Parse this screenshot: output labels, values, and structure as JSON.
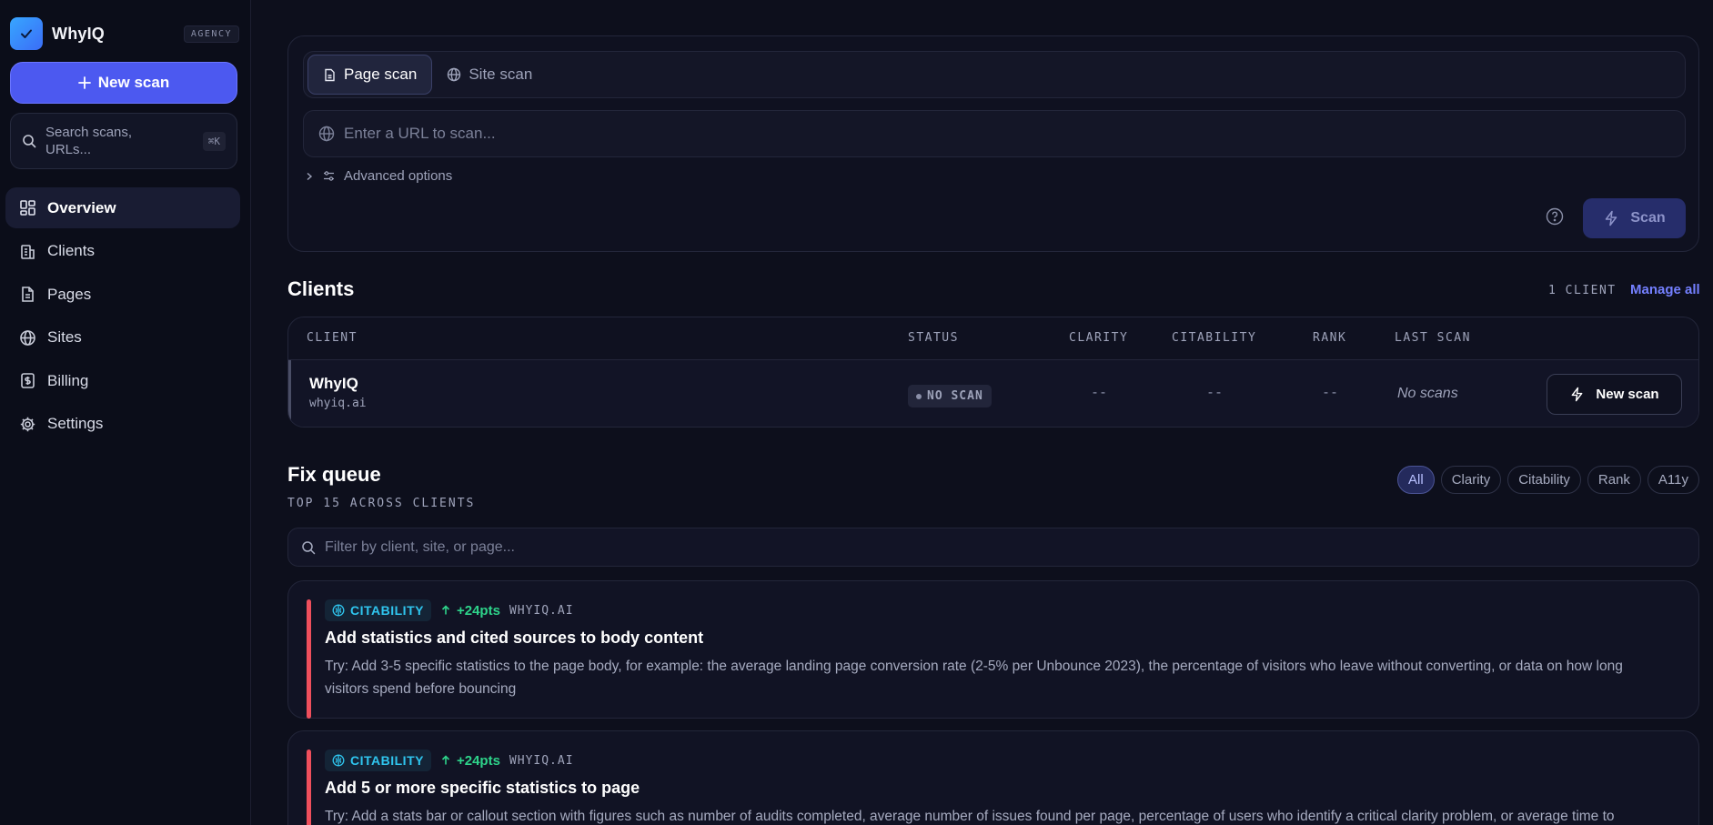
{
  "sidebar": {
    "brand": "WhyIQ",
    "badge": "AGENCY",
    "new_scan": "New scan",
    "search_placeholder": "Search scans, URLs...",
    "search_shortcut": "⌘K",
    "nav": [
      {
        "label": "Overview",
        "icon": "overview-icon",
        "active": true
      },
      {
        "label": "Clients",
        "icon": "building-icon"
      },
      {
        "label": "Pages",
        "icon": "document-icon"
      },
      {
        "label": "Sites",
        "icon": "globe-icon"
      },
      {
        "label": "Billing",
        "icon": "dollar-icon"
      },
      {
        "label": "Settings",
        "icon": "gear-icon"
      }
    ]
  },
  "scan": {
    "tabs": [
      {
        "label": "Page scan",
        "active": true
      },
      {
        "label": "Site scan"
      }
    ],
    "url_placeholder": "Enter a URL to scan...",
    "advanced": "Advanced options",
    "scan_button": "Scan"
  },
  "clients": {
    "title": "Clients",
    "count": "1 CLIENT",
    "manage": "Manage all",
    "columns": [
      "CLIENT",
      "STATUS",
      "CLARITY",
      "CITABILITY",
      "RANK",
      "LAST SCAN"
    ],
    "rows": [
      {
        "name": "WhyIQ",
        "domain": "whyiq.ai",
        "status": "NO SCAN",
        "clarity": "--",
        "citability": "--",
        "rank": "--",
        "last_scan": "No scans",
        "action": "New scan"
      }
    ]
  },
  "fix_queue": {
    "title": "Fix queue",
    "subtitle": "TOP 15 ACROSS CLIENTS",
    "filters": [
      "All",
      "Clarity",
      "Citability",
      "Rank",
      "A11y"
    ],
    "active_filter": "All",
    "filter_placeholder": "Filter by client, site, or page...",
    "items": [
      {
        "category": "CITABILITY",
        "points": "+24pts",
        "site": "WHYIQ.AI",
        "title": "Add statistics and cited sources to body content",
        "description": "Try: Add 3-5 specific statistics to the page body, for example: the average landing page conversion rate (2-5% per Unbounce 2023), the percentage of visitors who leave without converting, or data on how long visitors spend before bouncing"
      },
      {
        "category": "CITABILITY",
        "points": "+24pts",
        "site": "WHYIQ.AI",
        "title": "Add 5 or more specific statistics to page",
        "description": "Try: Add a stats bar or callout section with figures such as number of audits completed, average number of issues found per page, percentage of users who identify a critical clarity problem, or average time to"
      }
    ]
  },
  "colors": {
    "accent": "#4c59f0",
    "citability": "#2fc5ee",
    "points_up": "#2ed38a",
    "priority_bar": "#ef4f5c"
  }
}
